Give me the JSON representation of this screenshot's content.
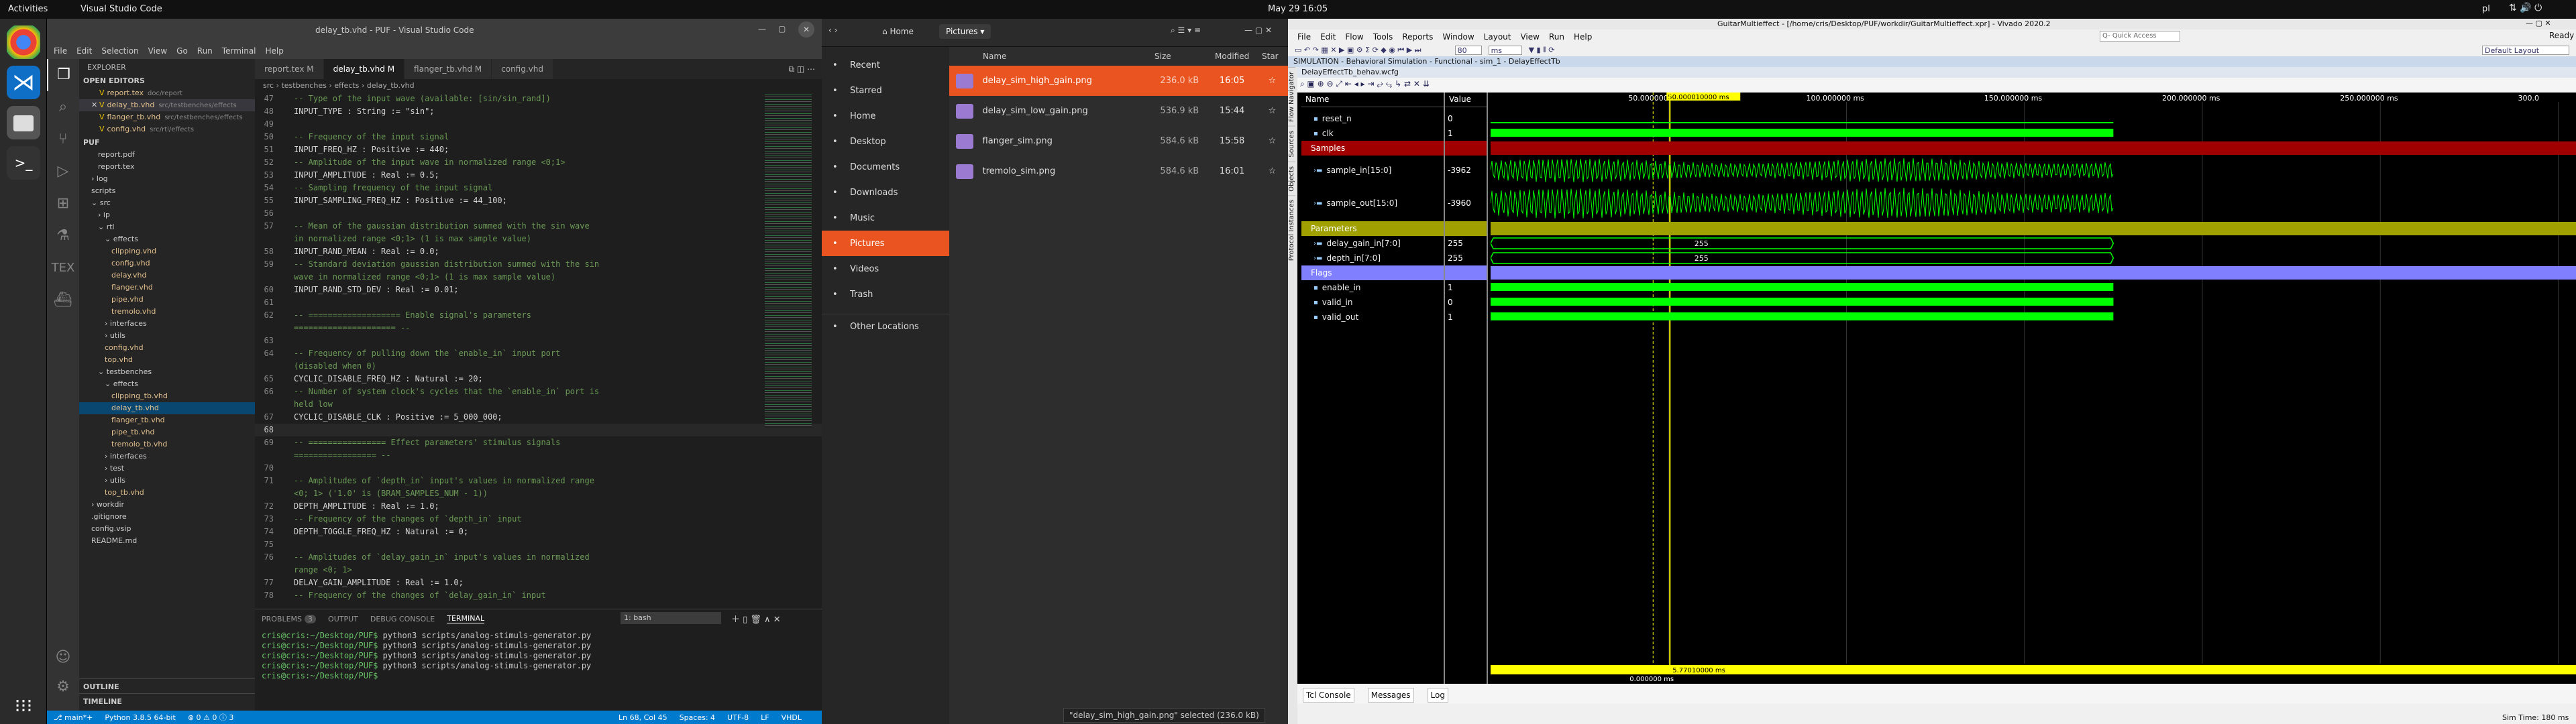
{
  "topbar": {
    "activities": "Activities",
    "app": "Visual Studio Code",
    "clock": "May 29  16:05",
    "lang": "pl"
  },
  "vscode": {
    "title": "delay_tb.vhd - PUF - Visual Studio Code",
    "menu": [
      "File",
      "Edit",
      "Selection",
      "View",
      "Go",
      "Run",
      "Terminal",
      "Help"
    ],
    "explorer_title": "EXPLORER",
    "open_editors": "OPEN EDITORS",
    "open_files": [
      {
        "mark": "",
        "name": "report.tex",
        "path": "doc/report"
      },
      {
        "mark": "✕",
        "name": "delay_tb.vhd",
        "path": "src/testbenches/effects"
      },
      {
        "mark": "",
        "name": "flanger_tb.vhd",
        "path": "src/testbenches/effects"
      },
      {
        "mark": "",
        "name": "config.vhd",
        "path": "src/rtl/effects"
      }
    ],
    "workspace": "PUF",
    "tree": [
      {
        "d": 2,
        "t": "report.pdf"
      },
      {
        "d": 2,
        "t": "report.tex"
      },
      {
        "d": 1,
        "t": "› log"
      },
      {
        "d": 1,
        "t": "scripts"
      },
      {
        "d": 1,
        "t": "⌄ src"
      },
      {
        "d": 2,
        "t": "› ip"
      },
      {
        "d": 2,
        "t": "⌄ rtl"
      },
      {
        "d": 3,
        "t": "⌄ effects"
      },
      {
        "d": 4,
        "t": "clipping.vhd"
      },
      {
        "d": 4,
        "t": "config.vhd"
      },
      {
        "d": 4,
        "t": "delay.vhd"
      },
      {
        "d": 4,
        "t": "flanger.vhd"
      },
      {
        "d": 4,
        "t": "pipe.vhd"
      },
      {
        "d": 4,
        "t": "tremolo.vhd"
      },
      {
        "d": 3,
        "t": "› interfaces"
      },
      {
        "d": 3,
        "t": "› utils"
      },
      {
        "d": 3,
        "t": "config.vhd"
      },
      {
        "d": 3,
        "t": "top.vhd"
      },
      {
        "d": 2,
        "t": "⌄ testbenches"
      },
      {
        "d": 3,
        "t": "⌄ effects"
      },
      {
        "d": 4,
        "t": "clipping_tb.vhd"
      },
      {
        "d": 4,
        "t": "delay_tb.vhd"
      },
      {
        "d": 4,
        "t": "flanger_tb.vhd"
      },
      {
        "d": 4,
        "t": "pipe_tb.vhd"
      },
      {
        "d": 4,
        "t": "tremolo_tb.vhd"
      },
      {
        "d": 3,
        "t": "› interfaces"
      },
      {
        "d": 3,
        "t": "› test"
      },
      {
        "d": 3,
        "t": "› utils"
      },
      {
        "d": 3,
        "t": "top_tb.vhd"
      },
      {
        "d": 1,
        "t": "› workdir"
      },
      {
        "d": 1,
        "t": ".gitignore"
      },
      {
        "d": 1,
        "t": "config.vsip"
      },
      {
        "d": 1,
        "t": "README.md"
      }
    ],
    "outline": "OUTLINE",
    "timeline": "TIMELINE",
    "tabs": [
      {
        "label": "report.tex  M",
        "active": false
      },
      {
        "label": "delay_tb.vhd  M",
        "active": true
      },
      {
        "label": "flanger_tb.vhd  M",
        "active": false
      },
      {
        "label": "config.vhd",
        "active": false
      }
    ],
    "breadcrumb": "src › testbenches › effects › delay_tb.vhd",
    "code": [
      {
        "n": "47",
        "c": "cm",
        "t": "-- Type of the input wave (available: [sin/sin_rand])"
      },
      {
        "n": "48",
        "c": "",
        "t": "INPUT_TYPE : String := \"sin\";"
      },
      {
        "n": "49",
        "c": "",
        "t": ""
      },
      {
        "n": "50",
        "c": "cm",
        "t": "-- Frequency of the input signal"
      },
      {
        "n": "51",
        "c": "",
        "t": "INPUT_FREQ_HZ : Positive := 440;"
      },
      {
        "n": "52",
        "c": "cm",
        "t": "-- Amplitude of the input wave in normalized range <0;1>"
      },
      {
        "n": "53",
        "c": "",
        "t": "INPUT_AMPLITUDE : Real := 0.5;"
      },
      {
        "n": "54",
        "c": "cm",
        "t": "-- Sampling frequency of the input signal"
      },
      {
        "n": "55",
        "c": "",
        "t": "INPUT_SAMPLING_FREQ_HZ : Positive := 44_100;"
      },
      {
        "n": "56",
        "c": "",
        "t": ""
      },
      {
        "n": "57",
        "c": "cm",
        "t": "-- Mean of the gaussian distribution summed with the sin wave"
      },
      {
        "n": "",
        "c": "cm",
        "t": "in normalized range <0;1> (1 is max sample value)"
      },
      {
        "n": "58",
        "c": "",
        "t": "INPUT_RAND_MEAN : Real := 0.0;"
      },
      {
        "n": "59",
        "c": "cm",
        "t": "-- Standard deviation gaussian distribution summed with the sin"
      },
      {
        "n": "",
        "c": "cm",
        "t": "wave in normalized range <0;1> (1 is max sample value)"
      },
      {
        "n": "60",
        "c": "",
        "t": "INPUT_RAND_STD_DEV : Real := 0.01;"
      },
      {
        "n": "61",
        "c": "",
        "t": ""
      },
      {
        "n": "62",
        "c": "cm",
        "t": "-- =================== Enable signal's parameters"
      },
      {
        "n": "",
        "c": "cm",
        "t": "===================== --"
      },
      {
        "n": "63",
        "c": "",
        "t": ""
      },
      {
        "n": "64",
        "c": "cm",
        "t": "-- Frequency of pulling down the `enable_in` input port"
      },
      {
        "n": "",
        "c": "cm",
        "t": "(disabled when 0)"
      },
      {
        "n": "65",
        "c": "",
        "t": "CYCLIC_DISABLE_FREQ_HZ : Natural := 20;"
      },
      {
        "n": "66",
        "c": "cm",
        "t": "-- Number of system clock's cycles that the `enable_in` port is"
      },
      {
        "n": "",
        "c": "cm",
        "t": "held low"
      },
      {
        "n": "67",
        "c": "",
        "t": "CYCLIC_DISABLE_CLK : Positive := 5_000_000;"
      },
      {
        "n": "68",
        "c": "",
        "t": ""
      },
      {
        "n": "69",
        "c": "cm",
        "t": "-- ================ Effect parameters' stimulus signals"
      },
      {
        "n": "",
        "c": "cm",
        "t": "================= --"
      },
      {
        "n": "70",
        "c": "",
        "t": ""
      },
      {
        "n": "71",
        "c": "cm",
        "t": "-- Amplitudes of `depth_in` input's values in normalized range"
      },
      {
        "n": "",
        "c": "cm",
        "t": "<0; 1> ('1.0' is (BRAM_SAMPLES_NUM - 1))"
      },
      {
        "n": "72",
        "c": "",
        "t": "DEPTH_AMPLITUDE : Real := 1.0;"
      },
      {
        "n": "73",
        "c": "cm",
        "t": "-- Frequency of the changes of `depth_in` input"
      },
      {
        "n": "74",
        "c": "",
        "t": "DEPTH_TOGGLE_FREQ_HZ : Natural := 0;"
      },
      {
        "n": "75",
        "c": "",
        "t": ""
      },
      {
        "n": "76",
        "c": "cm",
        "t": "-- Amplitudes of `delay_gain_in` input's values in normalized"
      },
      {
        "n": "",
        "c": "cm",
        "t": "range <0; 1>"
      },
      {
        "n": "77",
        "c": "",
        "t": "DELAY_GAIN_AMPLITUDE : Real := 1.0;"
      },
      {
        "n": "78",
        "c": "cm",
        "t": "-- Frequency of the changes of `delay_gain_in` input"
      }
    ],
    "panel_tabs": [
      "PROBLEMS",
      "OUTPUT",
      "DEBUG CONSOLE",
      "TERMINAL"
    ],
    "problems_count": "3",
    "terminal_select": "1: bash",
    "terminal_lines": [
      {
        "prompt": "cris@cris:~/Desktop/PUF$",
        "cmd": " python3 scripts/analog-stimuls-generator.py"
      },
      {
        "prompt": "cris@cris:~/Desktop/PUF$",
        "cmd": " python3 scripts/analog-stimuls-generator.py"
      },
      {
        "prompt": "cris@cris:~/Desktop/PUF$",
        "cmd": " python3 scripts/analog-stimuls-generator.py"
      },
      {
        "prompt": "cris@cris:~/Desktop/PUF$",
        "cmd": " python3 scripts/analog-stimuls-generator.py"
      },
      {
        "prompt": "cris@cris:~/Desktop/PUF$",
        "cmd": " "
      }
    ],
    "status_left": [
      "⎇ main*+",
      "Python 3.8.5 64-bit",
      "⊗ 0 ⚠ 0 ⓘ 3"
    ],
    "status_right": [
      "Ln 68, Col 45",
      "Spaces: 4",
      "UTF-8",
      "LF",
      "VHDL"
    ]
  },
  "nautilus": {
    "home": "Home",
    "folder": "Pictures",
    "sidebar": [
      {
        "icon": "clock-icon",
        "label": "Recent"
      },
      {
        "icon": "star-icon",
        "label": "Starred"
      },
      {
        "icon": "home-icon",
        "label": "Home"
      },
      {
        "icon": "desktop-icon",
        "label": "Desktop"
      },
      {
        "icon": "documents-icon",
        "label": "Documents"
      },
      {
        "icon": "download-icon",
        "label": "Downloads"
      },
      {
        "icon": "music-icon",
        "label": "Music"
      },
      {
        "icon": "pictures-icon",
        "label": "Pictures"
      },
      {
        "icon": "video-icon",
        "label": "Videos"
      },
      {
        "icon": "trash-icon",
        "label": "Trash"
      },
      {
        "icon": "plus-icon",
        "label": "Other Locations"
      }
    ],
    "columns": [
      "Name",
      "Size",
      "Modified",
      "Star"
    ],
    "files": [
      {
        "name": "delay_sim_high_gain.png",
        "size": "236.0 kB",
        "modified": "16:05",
        "selected": true
      },
      {
        "name": "delay_sim_low_gain.png",
        "size": "536.9 kB",
        "modified": "15:44",
        "selected": false
      },
      {
        "name": "flanger_sim.png",
        "size": "584.6 kB",
        "modified": "15:58",
        "selected": false
      },
      {
        "name": "tremolo_sim.png",
        "size": "584.6 kB",
        "modified": "16:01",
        "selected": false
      }
    ],
    "status": "\"delay_sim_high_gain.png\" selected (236.0 kB)"
  },
  "vivado": {
    "title": "GuitarMultieffect - [/home/cris/Desktop/PUF/workdir/GuitarMultieffect.xpr] - Vivado 2020.2",
    "ready": "Ready",
    "menu": [
      "File",
      "Edit",
      "Flow",
      "Tools",
      "Reports",
      "Window",
      "Layout",
      "View",
      "Run",
      "Help"
    ],
    "quick_access": "Q- Quick Access",
    "run_time": "80",
    "run_unit": "ms",
    "layout_select": "Default Layout",
    "sim_banner": "SIMULATION - Behavioral Simulation - Functional - sim_1 - DelayEffectTb",
    "wave_tab": "DelayEffectTb_behav.wcfg",
    "side_tabs": [
      "Flow Navigator",
      "Sources",
      "Objects",
      "Protocol Instances"
    ],
    "name_header": "Name",
    "value_header": "Value",
    "cursor_label": "50.000010000 ms",
    "cursor_bottom": "5.77010000 ms",
    "marker_delta": "0.000000 ms",
    "ruler": [
      "50.000000 ms",
      "100.000000 ms",
      "150.000000 ms",
      "200.000000 ms",
      "250.000000 ms",
      "300.0"
    ],
    "signals": [
      {
        "name": "reset_n",
        "value": "0",
        "kind": "bit"
      },
      {
        "name": "clk",
        "value": "1",
        "kind": "clk"
      },
      {
        "name": "Samples",
        "value": "",
        "kind": "group-red"
      },
      {
        "name": "sample_in[15:0]",
        "value": "-3962",
        "kind": "analog"
      },
      {
        "name": "sample_out[15:0]",
        "value": "-3960",
        "kind": "analog"
      },
      {
        "name": "Parameters",
        "value": "",
        "kind": "group-olive"
      },
      {
        "name": "delay_gain_in[7:0]",
        "value": "255",
        "kind": "bus"
      },
      {
        "name": "depth_in[7:0]",
        "value": "255",
        "kind": "bus"
      },
      {
        "name": "Flags",
        "value": "",
        "kind": "group-blue"
      },
      {
        "name": "enable_in",
        "value": "1",
        "kind": "bit"
      },
      {
        "name": "valid_in",
        "value": "0",
        "kind": "bit"
      },
      {
        "name": "valid_out",
        "value": "1",
        "kind": "bit"
      }
    ],
    "bottom_tabs": [
      "Tcl Console",
      "Messages",
      "Log"
    ],
    "sim_time": "Sim Time: 180 ms",
    "colors": {
      "green": "#00ff00",
      "yellow": "#ffff00",
      "red": "#a00000",
      "olive": "#a0a000",
      "blue": "#8080ff"
    }
  }
}
